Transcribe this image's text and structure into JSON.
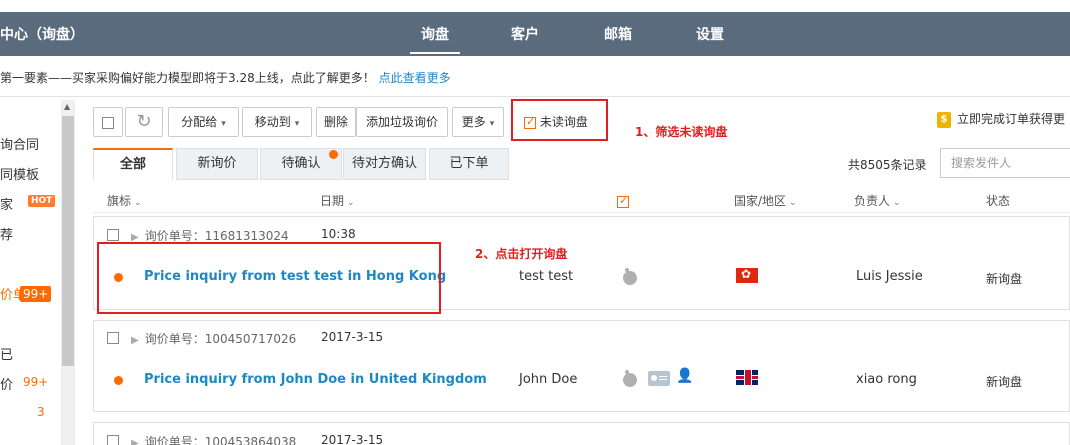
{
  "header": {
    "title": "中心（询盘）",
    "tabs": [
      {
        "label": "询盘",
        "active": true
      },
      {
        "label": "客户",
        "active": false
      },
      {
        "label": "邮箱",
        "active": false
      },
      {
        "label": "设置",
        "active": false
      }
    ]
  },
  "notice": {
    "text": "第一要素——买家采购偏好能力模型即将于3.28上线，点此了解更多！",
    "link": "点此查看更多"
  },
  "sidebar": {
    "items": [
      "询合同",
      "同模板",
      "家",
      "荐",
      "价单",
      "已",
      "价"
    ],
    "hot_badge": "HOT",
    "badge_99": "99+",
    "count_99": "99+",
    "count_3": "3"
  },
  "toolbar": {
    "assign": "分配给",
    "move_to": "移动到",
    "delete": "删除",
    "add_spam": "添加垃圾询价",
    "more": "更多",
    "unread": "未读询盘"
  },
  "annotations": {
    "step1": "1、筛选未读询盘",
    "step2": "2、点击打开询盘"
  },
  "promo": {
    "text": "立即完成订单获得更",
    "icon": "$"
  },
  "tabs": [
    {
      "label": "全部",
      "active": true
    },
    {
      "label": "新询价",
      "active": false
    },
    {
      "label": "待确认",
      "active": false
    },
    {
      "label": "待对方确认",
      "active": false
    },
    {
      "label": "已下单",
      "active": false
    }
  ],
  "records": "共8505条记录",
  "search": {
    "placeholder": "搜索发件人"
  },
  "columns": {
    "flag": "旗标",
    "date": "日期",
    "country": "国家/地区",
    "owner": "负责人",
    "status": "状态"
  },
  "rows": [
    {
      "id_label": "询价单号：11681313024",
      "date": "10:38",
      "subject": "Price inquiry from test test in Hong Kong",
      "buyer": "test test",
      "owner": "Luis Jessie",
      "status": "新询盘"
    },
    {
      "id_label": "询价单号：100450717026",
      "date": "2017-3-15",
      "subject": "Price inquiry from John Doe in United Kingdom",
      "buyer": "John Doe",
      "owner": "xiao rong",
      "status": "新询盘"
    },
    {
      "id_label": "询价单号：100453864038",
      "date": "2017-3-15"
    }
  ],
  "colors": {
    "header_bg": "#5b6b7e",
    "accent": "#ff6a00",
    "link": "#1e88c7",
    "annotation": "#e02020"
  }
}
